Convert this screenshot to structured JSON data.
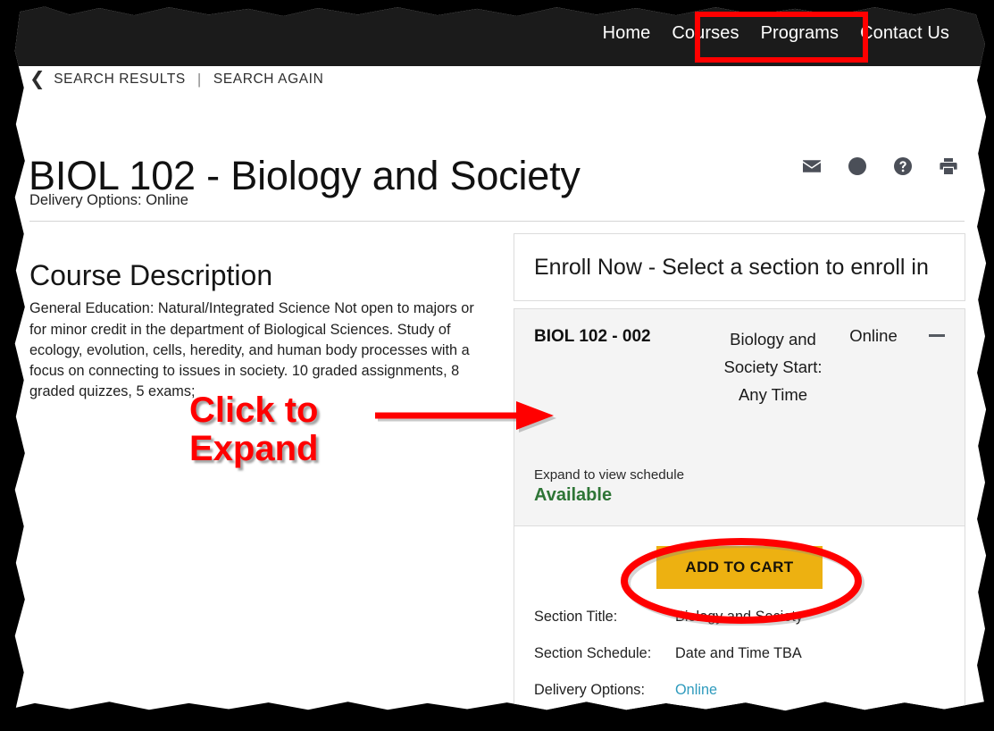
{
  "nav": {
    "items": [
      {
        "label": "Home",
        "name": "nav-home"
      },
      {
        "label": "Courses",
        "name": "nav-courses"
      },
      {
        "label": "Programs",
        "name": "nav-programs"
      },
      {
        "label": "Contact Us",
        "name": "nav-contact-us"
      }
    ],
    "background": "#1b1b1b"
  },
  "breadcrumb": {
    "back_label": "SEARCH RESULTS",
    "separator": "|",
    "again_label": "SEARCH AGAIN",
    "chevron": "‹"
  },
  "course": {
    "title": "BIOL 102 - Biology and Society",
    "delivery_options": "Delivery Options: Online",
    "description_heading": "Course Description",
    "description_body": "General Education: Natural/Integrated Science Not open to majors or for minor credit in the department of Biological Sciences. Study of ecology, evolution, cells, heredity, and human body processes with a focus on connecting to issues in society. 10 graded assignments, 8 graded quizzes, 5 exams;"
  },
  "header_icons": [
    {
      "name": "email-icon",
      "title": "Email"
    },
    {
      "name": "clock-icon",
      "title": "Clock"
    },
    {
      "name": "help-icon",
      "title": "Help"
    },
    {
      "name": "print-icon",
      "title": "Print"
    }
  ],
  "enroll": {
    "header": "Enroll Now - Select a section to enroll in",
    "section": {
      "code": "BIOL 102 - 002",
      "name": "Biology and Society Start: Any Time",
      "mode": "Online",
      "collapse_icon": "minus-icon",
      "expand_hint": "Expand to view schedule",
      "availability": "Available",
      "availability_color": "#2e7536"
    },
    "add_to_cart_label": "ADD TO CART",
    "add_to_cart_color": "#edb111",
    "details": [
      {
        "label": "Section Title:",
        "value": "Biology and Society",
        "is_link": false
      },
      {
        "label": "Section Schedule:",
        "value": "Date and Time TBA",
        "is_link": false
      },
      {
        "label": "Delivery Options:",
        "value": "Online",
        "is_link": true
      }
    ],
    "link_color": "#2f9bbd"
  },
  "annotations": {
    "color": "#ff0000",
    "click_to_expand": "Click to\nExpand",
    "click_to_expand_line1": "Click to",
    "click_to_expand_line2": "Expand",
    "nav_highlight_box": "Courses / Programs",
    "arrow": "right-arrow-annotation",
    "ellipse": "ellipse-annotation-add-to-cart"
  }
}
